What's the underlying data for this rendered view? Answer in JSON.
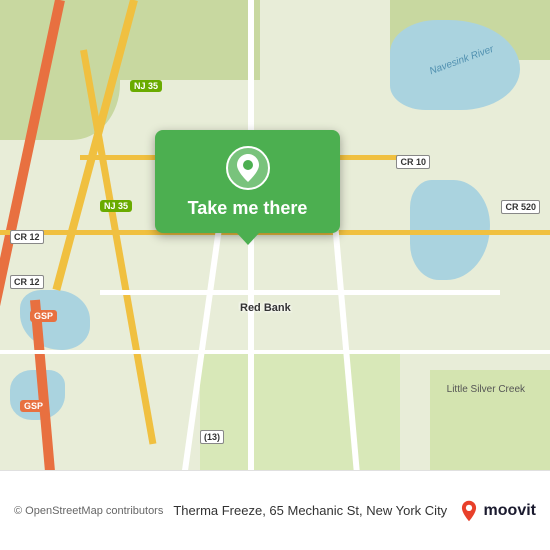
{
  "map": {
    "attribution": "© OpenStreetMap contributors",
    "place_name": "Red Bank",
    "navesink_label": "Navesink River",
    "little_silver_label": "Little Silver Creek",
    "roads": {
      "nj35": "NJ 35",
      "cr12": "CR 12",
      "cr10": "CR 10",
      "cr520": "CR 520",
      "gsp": "GSP",
      "r13": "(13)"
    }
  },
  "popup": {
    "label": "Take me there"
  },
  "bottom_bar": {
    "copyright": "© OpenStreetMap contributors",
    "address": "Therma Freeze, 65 Mechanic St, New York City"
  },
  "moovit": {
    "text": "moovit"
  }
}
